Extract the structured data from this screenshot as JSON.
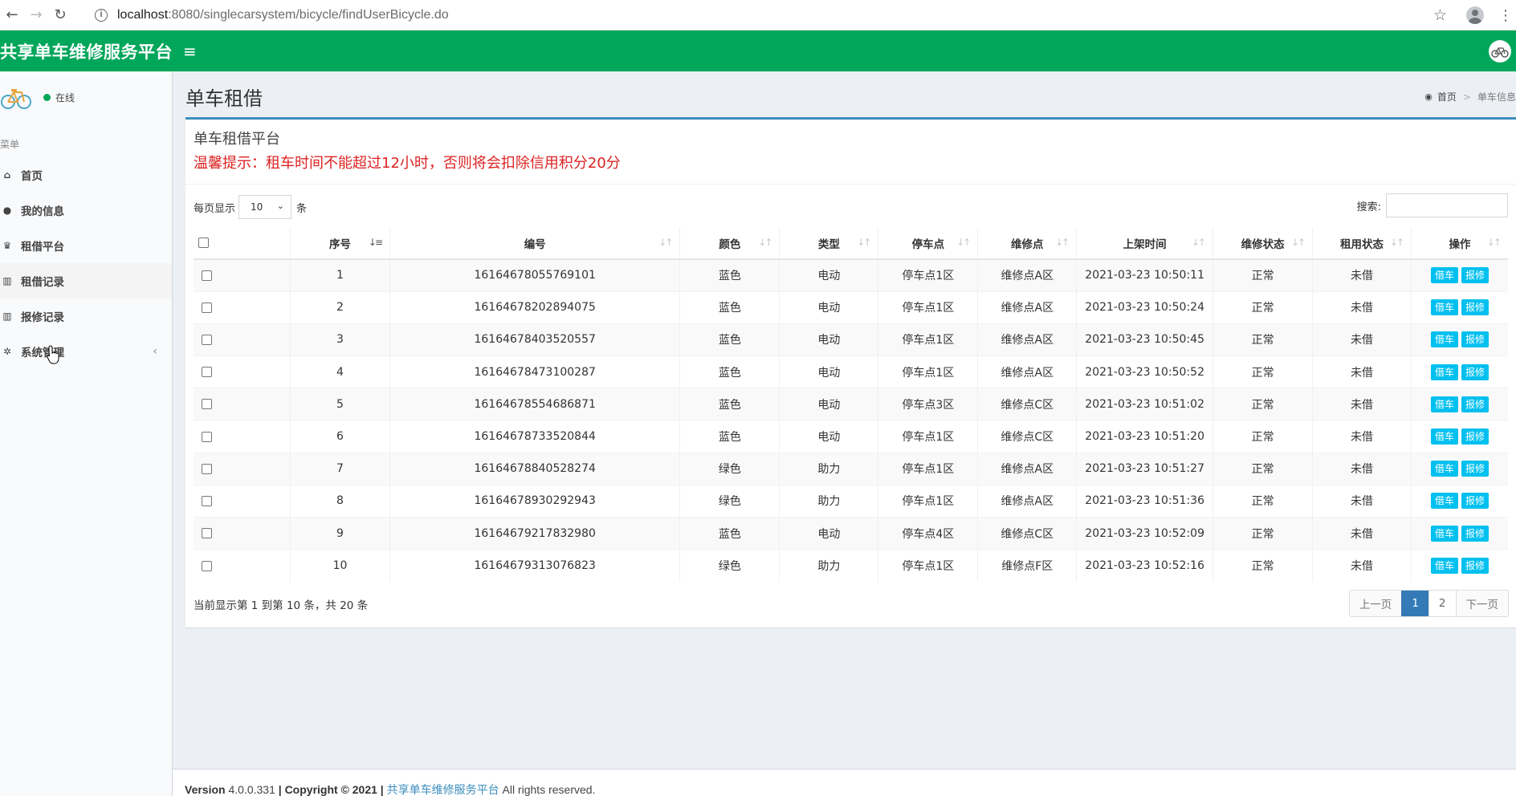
{
  "browser": {
    "url_host": "localhost",
    "url_path": ":8080/singlecarsystem/bicycle/findUserBicycle.do"
  },
  "header": {
    "brand": "共享单车维修服务平台",
    "hamburger": "≡"
  },
  "sidebar": {
    "status": "在线",
    "menu_label": "菜单",
    "items": [
      {
        "label": "首页",
        "icon": "home-icon",
        "glyph": "⌂"
      },
      {
        "label": "我的信息",
        "icon": "user-icon",
        "glyph": "●"
      },
      {
        "label": "租借平台",
        "icon": "trophy-icon",
        "glyph": "♛"
      },
      {
        "label": "租借记录",
        "icon": "bar-chart-icon",
        "glyph": "▥"
      },
      {
        "label": "报修记录",
        "icon": "bar-chart-icon",
        "glyph": "▥"
      },
      {
        "label": "系统管理",
        "icon": "gear-icon",
        "glyph": "✲"
      }
    ],
    "chevron": "‹"
  },
  "page": {
    "title": "单车租借",
    "breadcrumb_home": "首页",
    "breadcrumb_sep": ">",
    "breadcrumb_current": "单车信息"
  },
  "box": {
    "title": "单车租借平台",
    "warning": "温馨提示：租车时间不能超过12小时，否则将会扣除信用积分20分"
  },
  "table_controls": {
    "length_prefix": "每页显示",
    "length_value": "10",
    "length_suffix": "条",
    "search_label": "搜索:"
  },
  "table": {
    "columns": [
      "序号",
      "编号",
      "颜色",
      "类型",
      "停车点",
      "维修点",
      "上架时间",
      "维修状态",
      "租用状态",
      "操作"
    ],
    "rows": [
      {
        "no": "1",
        "code": "16164678055769101",
        "color": "蓝色",
        "type": "电动",
        "park": "停车点1区",
        "repair": "维修点A区",
        "time": "2021-03-23 10:50:11",
        "repair_status": "正常",
        "rent_status": "未借"
      },
      {
        "no": "2",
        "code": "16164678202894075",
        "color": "蓝色",
        "type": "电动",
        "park": "停车点1区",
        "repair": "维修点A区",
        "time": "2021-03-23 10:50:24",
        "repair_status": "正常",
        "rent_status": "未借"
      },
      {
        "no": "3",
        "code": "16164678403520557",
        "color": "蓝色",
        "type": "电动",
        "park": "停车点1区",
        "repair": "维修点A区",
        "time": "2021-03-23 10:50:45",
        "repair_status": "正常",
        "rent_status": "未借"
      },
      {
        "no": "4",
        "code": "16164678473100287",
        "color": "蓝色",
        "type": "电动",
        "park": "停车点1区",
        "repair": "维修点A区",
        "time": "2021-03-23 10:50:52",
        "repair_status": "正常",
        "rent_status": "未借"
      },
      {
        "no": "5",
        "code": "16164678554686871",
        "color": "蓝色",
        "type": "电动",
        "park": "停车点3区",
        "repair": "维修点C区",
        "time": "2021-03-23 10:51:02",
        "repair_status": "正常",
        "rent_status": "未借"
      },
      {
        "no": "6",
        "code": "16164678733520844",
        "color": "蓝色",
        "type": "电动",
        "park": "停车点1区",
        "repair": "维修点C区",
        "time": "2021-03-23 10:51:20",
        "repair_status": "正常",
        "rent_status": "未借"
      },
      {
        "no": "7",
        "code": "16164678840528274",
        "color": "绿色",
        "type": "助力",
        "park": "停车点1区",
        "repair": "维修点A区",
        "time": "2021-03-23 10:51:27",
        "repair_status": "正常",
        "rent_status": "未借"
      },
      {
        "no": "8",
        "code": "16164678930292943",
        "color": "绿色",
        "type": "助力",
        "park": "停车点1区",
        "repair": "维修点A区",
        "time": "2021-03-23 10:51:36",
        "repair_status": "正常",
        "rent_status": "未借"
      },
      {
        "no": "9",
        "code": "16164679217832980",
        "color": "蓝色",
        "type": "电动",
        "park": "停车点4区",
        "repair": "维修点C区",
        "time": "2021-03-23 10:52:09",
        "repair_status": "正常",
        "rent_status": "未借"
      },
      {
        "no": "10",
        "code": "16164679313076823",
        "color": "绿色",
        "type": "助力",
        "park": "停车点1区",
        "repair": "维修点F区",
        "time": "2021-03-23 10:52:16",
        "repair_status": "正常",
        "rent_status": "未借"
      }
    ],
    "borrow_label": "借车",
    "report_label": "报修"
  },
  "pagination": {
    "info": "当前显示第 1 到第 10 条，共 20 条",
    "prev": "上一页",
    "pages": [
      "1",
      "2"
    ],
    "next": "下一页"
  },
  "footer": {
    "version_label": "Version",
    "version": "4.0.0.331",
    "copyright": "| Copyright © 2021 |",
    "brand_link": "共享单车维修服务平台",
    "rights": "All rights reserved."
  },
  "colors": {
    "header_bg": "#00a65a",
    "accent_blue": "#3c8dbc",
    "action_btn": "#00c0ef",
    "warning_red": "#dd2222"
  }
}
